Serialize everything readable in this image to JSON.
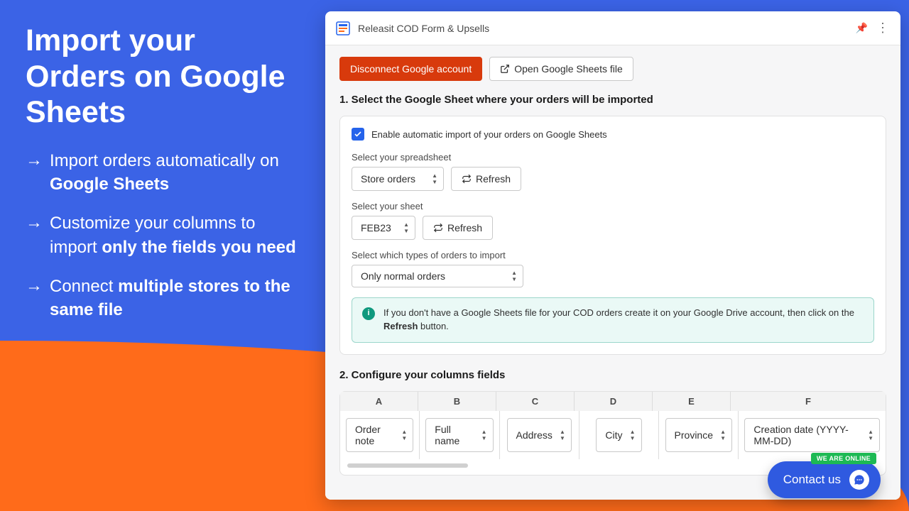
{
  "hero": {
    "title": "Import your Orders on Google Sheets",
    "bullets": [
      {
        "pre": "Import orders automatically on ",
        "bold": "Google\nSheets",
        "post": ""
      },
      {
        "pre": "Customize your columns to import ",
        "bold": "only the fields you need",
        "post": ""
      },
      {
        "pre": "Connect ",
        "bold": "multiple stores to the same file",
        "post": ""
      }
    ]
  },
  "app": {
    "title": "Releasit COD Form & Upsells",
    "btn_disconnect": "Disconnect Google account",
    "btn_open_sheets": "Open Google Sheets file",
    "section1_title": "1. Select the Google Sheet where your orders will be imported",
    "enable_label": "Enable automatic import of your orders on Google Sheets",
    "spreadsheet_label": "Select your spreadsheet",
    "spreadsheet_value": "Store orders",
    "refresh_label": "Refresh",
    "sheet_label": "Select your sheet",
    "sheet_value": "FEB23",
    "order_type_label": "Select which types of orders to import",
    "order_type_value": "Only normal orders",
    "notice_pre": "If you don't have a Google Sheets file for your COD orders create it on your Google Drive account, then click on the ",
    "notice_bold": "Refresh",
    "notice_post": " button.",
    "section2_title": "2. Configure your columns fields",
    "columns": [
      "A",
      "B",
      "C",
      "D",
      "E",
      "F"
    ],
    "fields": [
      "Order note",
      "Full name",
      "Address",
      "City",
      "Province",
      "Creation date (YYYY-MM-DD)"
    ]
  },
  "chat": {
    "label": "Contact us",
    "badge": "WE ARE ONLINE"
  }
}
